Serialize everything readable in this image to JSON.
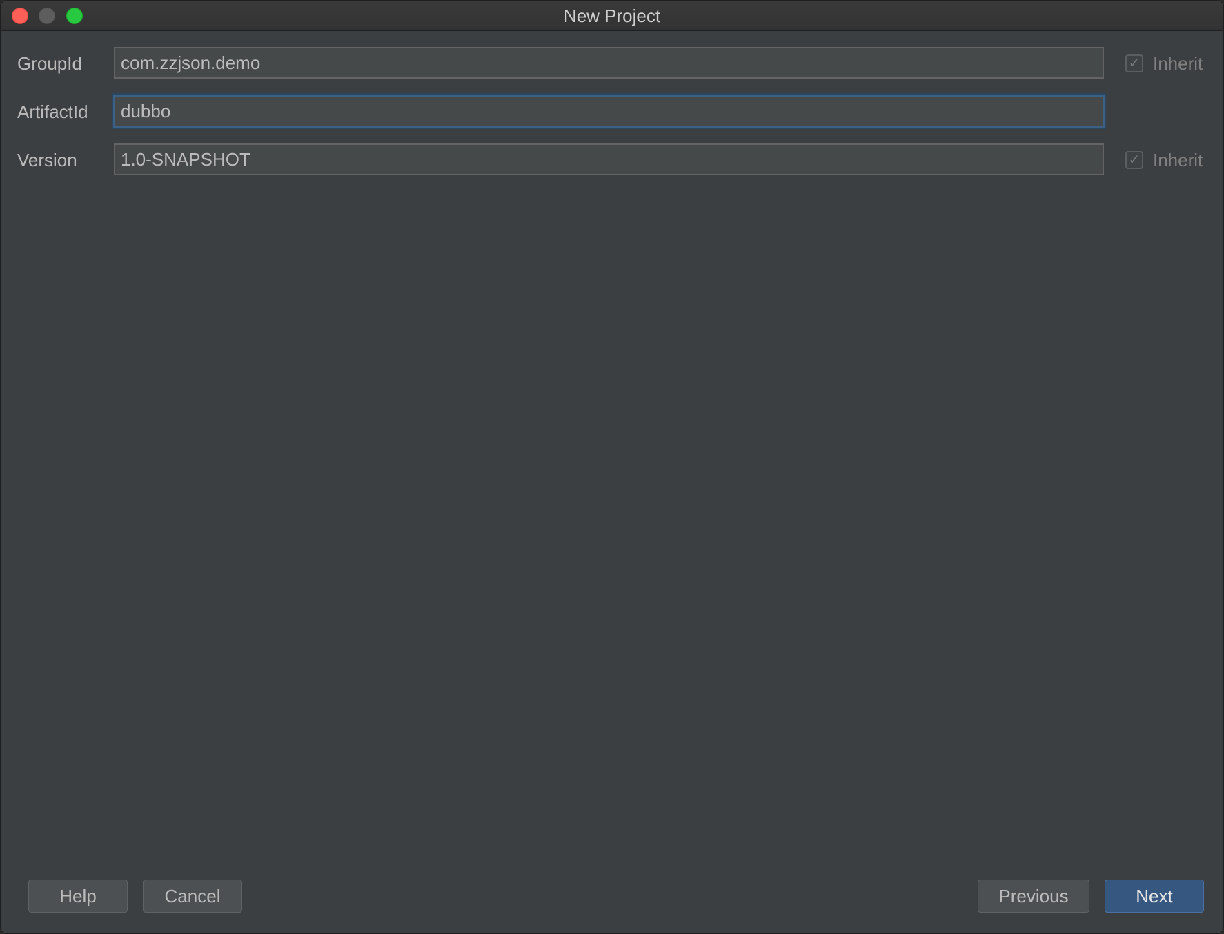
{
  "window": {
    "title": "New Project"
  },
  "form": {
    "fields": [
      {
        "label": "GroupId",
        "value": "com.zzjson.demo",
        "inherit": true,
        "inherit_label": "Inherit"
      },
      {
        "label": "ArtifactId",
        "value": "dubbo",
        "focused": true
      },
      {
        "label": "Version",
        "value": "1.0-SNAPSHOT",
        "inherit": true,
        "inherit_label": "Inherit"
      }
    ]
  },
  "footer": {
    "help_label": "Help",
    "cancel_label": "Cancel",
    "previous_label": "Previous",
    "next_label": "Next"
  },
  "icons": {
    "check": "check-icon"
  },
  "colors": {
    "background": "#3c3f41",
    "input_bg": "#45494a",
    "focus_border": "#3d6185",
    "primary_button": "#365880",
    "close": "#fe5f57",
    "zoom": "#28c840"
  }
}
